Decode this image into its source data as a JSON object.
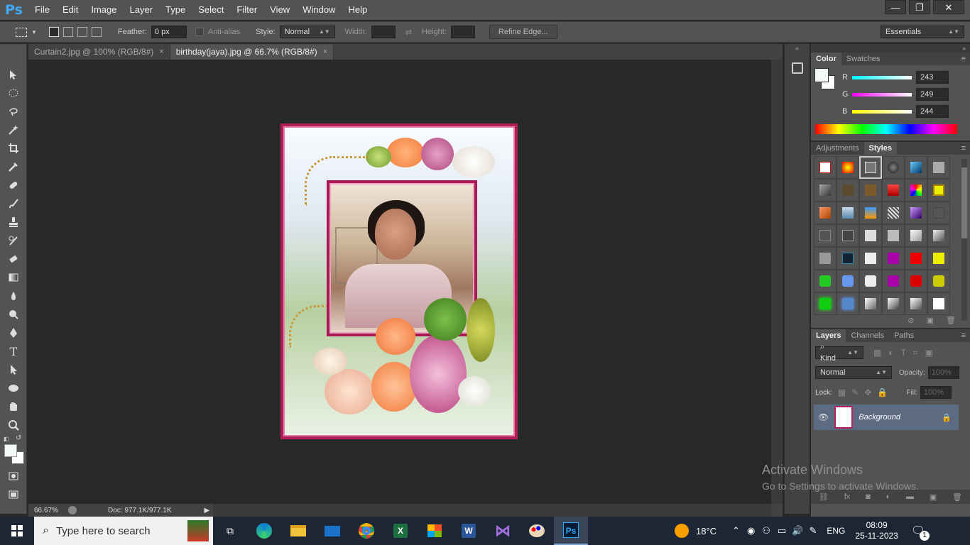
{
  "app": {
    "logo": "Ps"
  },
  "menu": [
    "File",
    "Edit",
    "Image",
    "Layer",
    "Type",
    "Select",
    "Filter",
    "View",
    "Window",
    "Help"
  ],
  "window_controls": {
    "minimize": "—",
    "restore": "❐",
    "close": "✕"
  },
  "options": {
    "feather_label": "Feather:",
    "feather_value": "0 px",
    "antialias_label": "Anti-alias",
    "style_label": "Style:",
    "style_value": "Normal",
    "width_label": "Width:",
    "height_label": "Height:",
    "refine_label": "Refine Edge...",
    "workspace": "Essentials"
  },
  "tabs": [
    {
      "label": "Curtain2.jpg @ 100% (RGB/8#)",
      "close": "×"
    },
    {
      "label": "birthday(jaya).jpg @ 66.7% (RGB/8#)",
      "close": "×"
    }
  ],
  "status": {
    "zoom": "66.67%",
    "doc": "Doc: 977.1K/977.1K"
  },
  "color_panel": {
    "tabs": [
      "Color",
      "Swatches"
    ],
    "r_label": "R",
    "g_label": "G",
    "b_label": "B",
    "r": "243",
    "g": "249",
    "b": "244"
  },
  "styles_panel": {
    "tabs": [
      "Adjustments",
      "Styles"
    ]
  },
  "layers_panel": {
    "tabs": [
      "Layers",
      "Channels",
      "Paths"
    ],
    "kind": "Kind",
    "blend": "Normal",
    "opacity_label": "Opacity:",
    "opacity": "100%",
    "lock_label": "Lock:",
    "fill_label": "Fill:",
    "fill": "100%",
    "layer_name": "Background"
  },
  "watermark": {
    "line1": "Activate Windows",
    "line2": "Go to Settings to activate Windows."
  },
  "taskbar": {
    "search": "Type here to search",
    "weather": "18°C",
    "lang": "ENG",
    "time": "08:09",
    "date": "25-11-2023",
    "notif": "1"
  },
  "colors": {
    "accent": "#3fa9f5",
    "frame": "#b11f59",
    "layer_sel": "#5c6a82"
  }
}
